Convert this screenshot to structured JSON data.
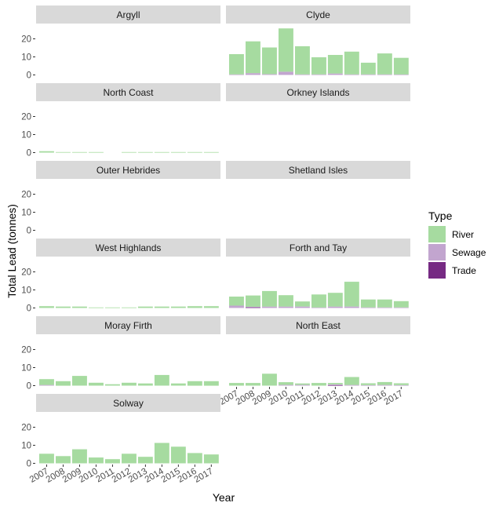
{
  "chart_data": {
    "type": "bar",
    "stacked": true,
    "facet_layout": "wrap-2-columns",
    "xlabel": "Year",
    "ylabel": "Total Lead (tonnes)",
    "ylim": [
      0,
      25
    ],
    "yticks": [
      0,
      10,
      20
    ],
    "categories": [
      "2007",
      "2008",
      "2009",
      "2010",
      "2011",
      "2012",
      "2013",
      "2014",
      "2015",
      "2016",
      "2017"
    ],
    "legend": {
      "title": "Type",
      "placement": "right",
      "entries": [
        {
          "name": "River",
          "color": "#A6DBA0"
        },
        {
          "name": "Sewage",
          "color": "#C2A5CF"
        },
        {
          "name": "Trade",
          "color": "#762A83"
        }
      ]
    },
    "panels": [
      {
        "name": "Argyll",
        "series": {
          "River": [
            null,
            null,
            null,
            null,
            null,
            null,
            null,
            null,
            null,
            null,
            null
          ],
          "Sewage": [
            null,
            null,
            null,
            null,
            null,
            null,
            null,
            null,
            null,
            null,
            null
          ],
          "Trade": [
            null,
            null,
            null,
            null,
            null,
            null,
            null,
            null,
            null,
            null,
            null
          ]
        }
      },
      {
        "name": "Clyde",
        "series": {
          "River": [
            11.2,
            17.6,
            14.8,
            24.0,
            15.6,
            9.5,
            10.3,
            12.6,
            6.5,
            11.6,
            9.2
          ],
          "Sewage": [
            0.3,
            1.0,
            0.4,
            1.8,
            0.3,
            0.3,
            0.8,
            0.3,
            0.3,
            0.3,
            0.3
          ],
          "Trade": [
            0,
            0,
            0,
            0,
            0,
            0,
            0,
            0,
            0,
            0,
            0
          ]
        }
      },
      {
        "name": "North Coast",
        "series": {
          "River": [
            0.8,
            0.3,
            0.3,
            0.3,
            null,
            0.3,
            0.3,
            0.3,
            0.3,
            0.3,
            0.3
          ],
          "Sewage": [
            0,
            0,
            0,
            0,
            null,
            0,
            0,
            0,
            0,
            0,
            0
          ],
          "Trade": [
            0,
            0,
            0,
            0,
            null,
            0,
            0,
            0,
            0,
            0,
            0
          ]
        }
      },
      {
        "name": "Orkney Islands",
        "series": {
          "River": [
            null,
            null,
            null,
            null,
            null,
            null,
            null,
            null,
            null,
            null,
            null
          ],
          "Sewage": [
            null,
            null,
            null,
            null,
            null,
            null,
            null,
            null,
            null,
            null,
            null
          ],
          "Trade": [
            null,
            null,
            null,
            null,
            null,
            null,
            null,
            null,
            null,
            null,
            null
          ]
        }
      },
      {
        "name": "Outer Hebrides",
        "series": {
          "River": [
            null,
            null,
            null,
            null,
            null,
            null,
            null,
            null,
            null,
            null,
            null
          ],
          "Sewage": [
            null,
            null,
            null,
            null,
            null,
            null,
            null,
            null,
            null,
            null,
            null
          ],
          "Trade": [
            null,
            null,
            null,
            null,
            null,
            null,
            null,
            null,
            null,
            null,
            null
          ]
        }
      },
      {
        "name": "Shetland Isles",
        "series": {
          "River": [
            null,
            null,
            null,
            null,
            null,
            null,
            null,
            null,
            null,
            null,
            null
          ],
          "Sewage": [
            null,
            null,
            null,
            null,
            null,
            null,
            null,
            null,
            null,
            null,
            null
          ],
          "Trade": [
            null,
            null,
            null,
            null,
            null,
            null,
            null,
            null,
            null,
            null,
            null
          ]
        }
      },
      {
        "name": "West Highlands",
        "series": {
          "River": [
            1.0,
            0.8,
            0.8,
            0.3,
            0.3,
            0.3,
            0.8,
            0.8,
            0.8,
            1.0,
            1.0
          ],
          "Sewage": [
            0,
            0,
            0,
            0,
            0,
            0,
            0,
            0,
            0,
            0,
            0
          ],
          "Trade": [
            0,
            0,
            0,
            0,
            0,
            0,
            0,
            0,
            0,
            0,
            0
          ]
        }
      },
      {
        "name": "Forth and Tay",
        "series": {
          "River": [
            5.0,
            6.2,
            8.6,
            6.3,
            2.8,
            7.2,
            7.6,
            13.7,
            4.4,
            4.4,
            3.5
          ],
          "Sewage": [
            1.3,
            0.3,
            0.8,
            0.8,
            0.8,
            0.3,
            0.8,
            0.8,
            0.3,
            0.3,
            0.3
          ],
          "Trade": [
            0,
            0.4,
            0,
            0,
            0,
            0,
            0,
            0,
            0,
            0,
            0
          ]
        }
      },
      {
        "name": "Moray Firth",
        "series": {
          "River": [
            3.2,
            2.5,
            5.4,
            1.6,
            0.8,
            1.6,
            1.2,
            5.9,
            1.2,
            2.5,
            2.5
          ],
          "Sewage": [
            0.4,
            0,
            0,
            0,
            0,
            0,
            0,
            0,
            0,
            0,
            0
          ],
          "Trade": [
            0,
            0,
            0,
            0,
            0,
            0,
            0,
            0,
            0,
            0,
            0
          ]
        }
      },
      {
        "name": "North East",
        "series": {
          "River": [
            1.5,
            1.5,
            6.6,
            1.5,
            0.8,
            1.5,
            0.8,
            4.4,
            1.0,
            1.6,
            1.0
          ],
          "Sewage": [
            0,
            0,
            0,
            0.4,
            0.4,
            0,
            0.4,
            0.4,
            0.3,
            0.4,
            0.3
          ],
          "Trade": [
            0,
            0,
            0,
            0,
            0,
            0,
            0.3,
            0,
            0,
            0,
            0
          ]
        }
      },
      {
        "name": "Solway",
        "series": {
          "River": [
            5.3,
            4.0,
            7.8,
            3.2,
            2.3,
            5.3,
            3.6,
            11.3,
            9.2,
            5.7,
            4.9
          ],
          "Sewage": [
            0,
            0,
            0,
            0,
            0,
            0,
            0,
            0,
            0,
            0,
            0
          ],
          "Trade": [
            0,
            0,
            0,
            0,
            0,
            0,
            0,
            0,
            0,
            0,
            0
          ]
        }
      }
    ]
  }
}
